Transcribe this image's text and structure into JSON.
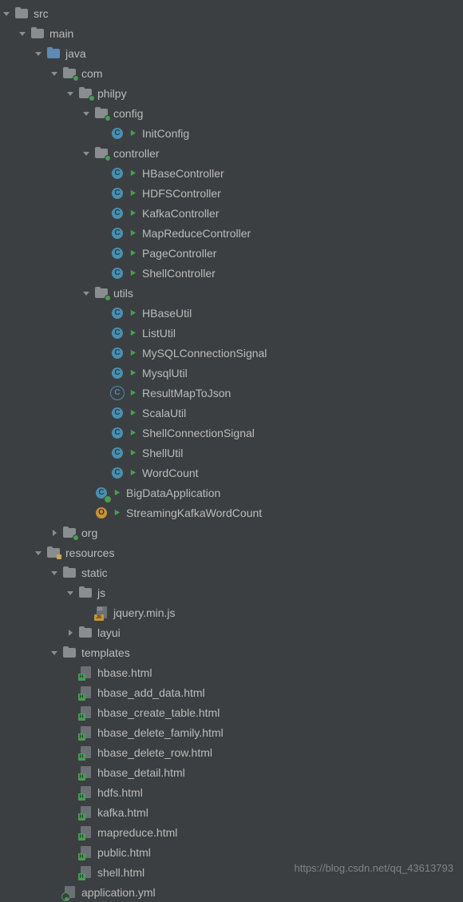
{
  "colors": {
    "background": "#3c3f41",
    "text": "#bbbbbb",
    "folder_gray": "#8a8d8f",
    "folder_blue": "#5f8ab5",
    "class_cyan": "#4a8fb0",
    "class_orange": "#c9933c",
    "run_green": "#499c54",
    "html_badge": "#499c54"
  },
  "watermark": "https://blog.csdn.net/qq_43613793",
  "tree": [
    {
      "depth": 0,
      "arrow": "down",
      "icon": "folder-gray",
      "label": "src"
    },
    {
      "depth": 1,
      "arrow": "down",
      "icon": "folder-gray",
      "label": "main"
    },
    {
      "depth": 2,
      "arrow": "down",
      "icon": "folder-blue",
      "label": "java"
    },
    {
      "depth": 3,
      "arrow": "down",
      "icon": "folder-gray-pkg",
      "label": "com"
    },
    {
      "depth": 4,
      "arrow": "down",
      "icon": "folder-gray-pkg",
      "label": "philpy"
    },
    {
      "depth": 5,
      "arrow": "down",
      "icon": "folder-gray-pkg",
      "label": "config"
    },
    {
      "depth": 6,
      "arrow": "none",
      "icon": "class-c",
      "run": true,
      "label": "InitConfig"
    },
    {
      "depth": 5,
      "arrow": "down",
      "icon": "folder-gray-pkg",
      "label": "controller"
    },
    {
      "depth": 6,
      "arrow": "none",
      "icon": "class-c",
      "run": true,
      "label": "HBaseController"
    },
    {
      "depth": 6,
      "arrow": "none",
      "icon": "class-c",
      "run": true,
      "label": "HDFSController"
    },
    {
      "depth": 6,
      "arrow": "none",
      "icon": "class-c",
      "run": true,
      "label": "KafkaController"
    },
    {
      "depth": 6,
      "arrow": "none",
      "icon": "class-c",
      "run": true,
      "label": "MapReduceController"
    },
    {
      "depth": 6,
      "arrow": "none",
      "icon": "class-c",
      "run": true,
      "label": "PageController"
    },
    {
      "depth": 6,
      "arrow": "none",
      "icon": "class-c",
      "run": true,
      "label": "ShellController"
    },
    {
      "depth": 5,
      "arrow": "down",
      "icon": "folder-gray-pkg",
      "label": "utils"
    },
    {
      "depth": 6,
      "arrow": "none",
      "icon": "class-c",
      "run": true,
      "label": "HBaseUtil"
    },
    {
      "depth": 6,
      "arrow": "none",
      "icon": "class-c",
      "run": true,
      "label": "ListUtil"
    },
    {
      "depth": 6,
      "arrow": "none",
      "icon": "class-c",
      "run": true,
      "label": "MySQLConnectionSignal"
    },
    {
      "depth": 6,
      "arrow": "none",
      "icon": "class-c",
      "run": true,
      "label": "MysqlUtil"
    },
    {
      "depth": 6,
      "arrow": "none",
      "icon": "class-ring",
      "run": true,
      "label": "ResultMapToJson"
    },
    {
      "depth": 6,
      "arrow": "none",
      "icon": "class-c",
      "run": true,
      "label": "ScalaUtil"
    },
    {
      "depth": 6,
      "arrow": "none",
      "icon": "class-c",
      "run": true,
      "label": "ShellConnectionSignal"
    },
    {
      "depth": 6,
      "arrow": "none",
      "icon": "class-c",
      "run": true,
      "label": "ShellUtil"
    },
    {
      "depth": 6,
      "arrow": "none",
      "icon": "class-c",
      "run": true,
      "label": "WordCount"
    },
    {
      "depth": 5,
      "arrow": "none",
      "icon": "class-app",
      "run": true,
      "label": "BigDataApplication"
    },
    {
      "depth": 5,
      "arrow": "none",
      "icon": "class-o",
      "run": true,
      "label": "StreamingKafkaWordCount"
    },
    {
      "depth": 3,
      "arrow": "right",
      "icon": "folder-gray-pkg",
      "label": "org"
    },
    {
      "depth": 2,
      "arrow": "down",
      "icon": "folder-res",
      "label": "resources"
    },
    {
      "depth": 3,
      "arrow": "down",
      "icon": "folder-gray",
      "label": "static"
    },
    {
      "depth": 4,
      "arrow": "down",
      "icon": "folder-gray",
      "label": "js"
    },
    {
      "depth": 5,
      "arrow": "none",
      "icon": "file-js",
      "label": "jquery.min.js"
    },
    {
      "depth": 4,
      "arrow": "right",
      "icon": "folder-gray",
      "label": "layui"
    },
    {
      "depth": 3,
      "arrow": "down",
      "icon": "folder-gray",
      "label": "templates"
    },
    {
      "depth": 4,
      "arrow": "none",
      "icon": "file-html",
      "label": "hbase.html"
    },
    {
      "depth": 4,
      "arrow": "none",
      "icon": "file-html",
      "label": "hbase_add_data.html"
    },
    {
      "depth": 4,
      "arrow": "none",
      "icon": "file-html",
      "label": "hbase_create_table.html"
    },
    {
      "depth": 4,
      "arrow": "none",
      "icon": "file-html",
      "label": "hbase_delete_family.html"
    },
    {
      "depth": 4,
      "arrow": "none",
      "icon": "file-html",
      "label": "hbase_delete_row.html"
    },
    {
      "depth": 4,
      "arrow": "none",
      "icon": "file-html",
      "label": "hbase_detail.html"
    },
    {
      "depth": 4,
      "arrow": "none",
      "icon": "file-html",
      "label": "hdfs.html"
    },
    {
      "depth": 4,
      "arrow": "none",
      "icon": "file-html",
      "label": "kafka.html"
    },
    {
      "depth": 4,
      "arrow": "none",
      "icon": "file-html",
      "label": "mapreduce.html"
    },
    {
      "depth": 4,
      "arrow": "none",
      "icon": "file-html",
      "label": "public.html"
    },
    {
      "depth": 4,
      "arrow": "none",
      "icon": "file-html",
      "label": "shell.html"
    },
    {
      "depth": 3,
      "arrow": "none",
      "icon": "file-yml",
      "label": "application.yml"
    }
  ]
}
